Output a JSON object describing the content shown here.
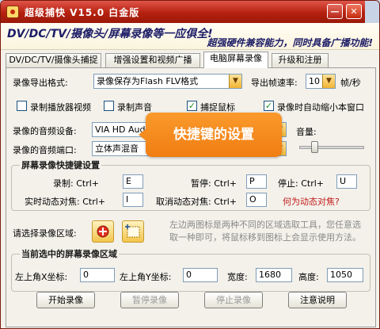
{
  "window": {
    "title": "超级捕快 V15.0 白金版",
    "minimize_glyph": "—",
    "close_glyph": "✕"
  },
  "banner": {
    "slogan": "DV/DC/TV/摄像头/屏幕录像等一应俱全!",
    "subtitle": "超强硬件兼容能力，同时具备广播功能!"
  },
  "tabs": [
    {
      "label": "DV/DC/TV/摄像头捕捉",
      "active": false
    },
    {
      "label": "增强设置和视频广播",
      "active": false
    },
    {
      "label": "电脑屏幕录像",
      "active": true
    },
    {
      "label": "升级和注册",
      "active": false
    }
  ],
  "settings": {
    "format_label": "录像导出格式:",
    "format_value": "录像保存为Flash FLV格式",
    "fps_label": "导出帧速率:",
    "fps_value": "10",
    "fps_unit": "帧/秒",
    "record_player_label": "录制播放器视频",
    "record_player_checked": false,
    "record_sound_label": "录制声音",
    "record_sound_checked": false,
    "capture_mouse_label": "捕捉鼠标",
    "capture_mouse_checked": true,
    "auto_minimize_label": "录像时自动缩小本窗口",
    "auto_minimize_checked": true,
    "audio_device_label": "录像的音频设备:",
    "audio_device_value": "VIA HD Audio",
    "audio_port_label": "录像的音频端口:",
    "audio_port_value": "立体声混音",
    "volume_label": "音量:",
    "volume_level": 0.2
  },
  "hotkeys": {
    "title": "屏幕录像快捷键设置",
    "record_label": "录制: Ctrl+",
    "record_key": "E",
    "pause_label": "暂停: Ctrl+",
    "pause_key": "P",
    "stop_label": "停止: Ctrl+",
    "stop_key": "U",
    "dynamic_focus_label": "实时动态对焦: Ctrl+",
    "dynamic_focus_key": "I",
    "cancel_focus_label": "取消动态对焦: Ctrl+",
    "cancel_focus_key": "O",
    "help_link": "何为动态对焦?"
  },
  "region": {
    "label": "请选择录像区域:",
    "tip": "左边两图标是两种不同的区域选取工具，您任意选取一种即可，将鼠标移到图标上会显示使用方法。"
  },
  "current_region": {
    "title": "当前选中的屏幕录像区域",
    "x_label": "左上角X坐标:",
    "x_value": "0",
    "y_label": "左上角Y坐标:",
    "y_value": "0",
    "width_label": "宽度:",
    "width_value": "1680",
    "height_label": "高度:",
    "height_value": "1050"
  },
  "buttons": {
    "start": "开始录像",
    "pause": "暂停录像",
    "stop": "停止录像",
    "notes": "注意说明"
  },
  "tooltip": "快捷键的设置"
}
